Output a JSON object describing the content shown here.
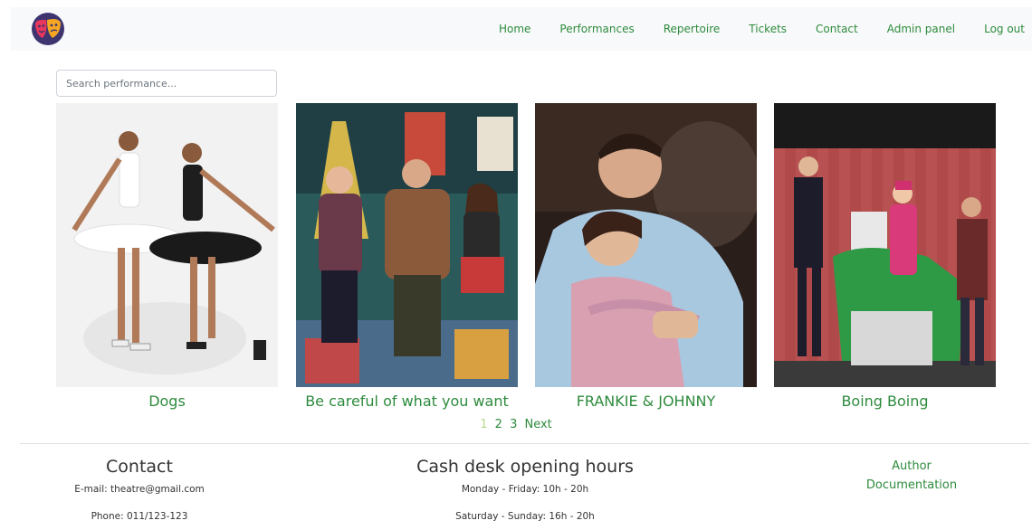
{
  "nav": {
    "items": [
      "Home",
      "Performances",
      "Repertoire",
      "Tickets",
      "Contact",
      "Admin panel",
      "Log out"
    ]
  },
  "logo_icon": "theatre-masks-icon",
  "search": {
    "placeholder": "Search performance...",
    "value": ""
  },
  "cards": [
    {
      "title": "Dogs"
    },
    {
      "title": "Be careful of what you want"
    },
    {
      "title": "FRANKIE & JOHNNY"
    },
    {
      "title": "Boing Boing"
    }
  ],
  "pagination": {
    "pages": [
      "1",
      "2",
      "3"
    ],
    "active": "1",
    "next": "Next"
  },
  "footer": {
    "contact": {
      "heading": "Contact",
      "email": "E-mail: theatre@gmail.com",
      "phone": "Phone: 011/123-123"
    },
    "hours": {
      "heading": "Cash desk opening hours",
      "weekdays": "Monday - Friday: 10h - 20h",
      "weekend": "Saturday - Sunday: 16h - 20h"
    },
    "links": {
      "author": "Author",
      "documentation": "Documentation"
    }
  },
  "colors": {
    "accent": "#2e8b3d",
    "active_page": "#b6d98a",
    "navbar_bg": "#f8f9fa"
  }
}
